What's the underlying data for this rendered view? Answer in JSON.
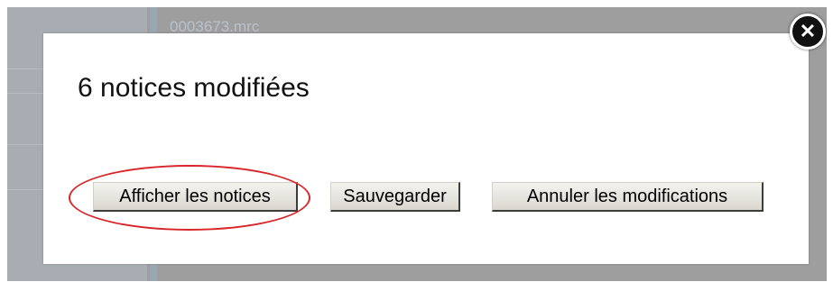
{
  "background": {
    "record_label": "0003673.mrc"
  },
  "dialog": {
    "title": "6 notices modifiées",
    "buttons": {
      "show_records": "Afficher les notices",
      "save": "Sauvegarder",
      "cancel_changes": "Annuler les modifications"
    },
    "close_icon": {
      "icon": "close-icon",
      "glyph": "✕"
    }
  },
  "annotation": {
    "highlight_color": "#d8262a",
    "highlighted_target": "show_records"
  }
}
